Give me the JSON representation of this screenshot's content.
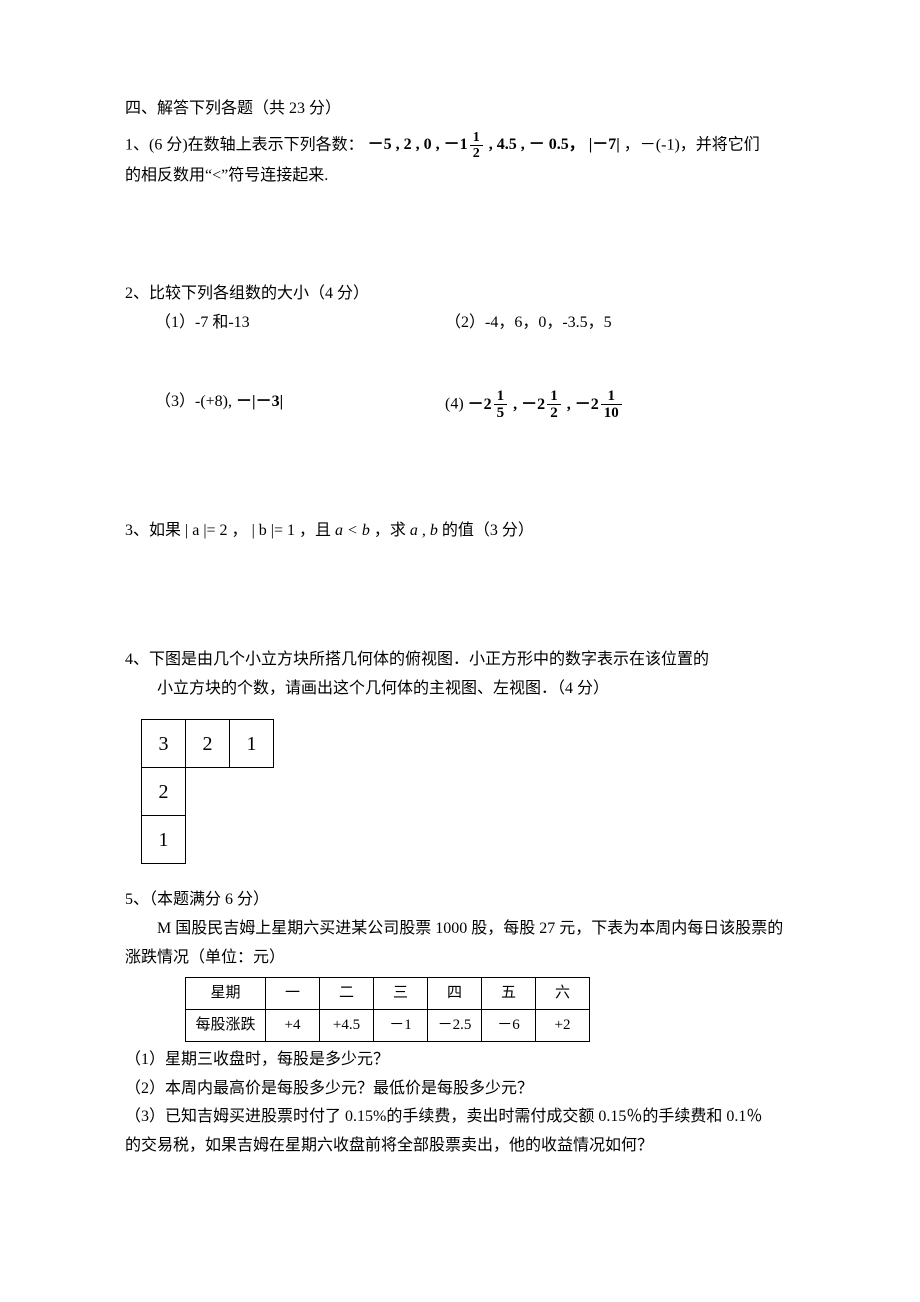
{
  "section": {
    "title": "四、解答下列各题（共 23 分）"
  },
  "q1": {
    "prefix": " 1、(6 分)在数轴上表示下列各数：",
    "nums_lead": "－5 , 2 , 0 , －1",
    "nums_mid": " , 4.5 , － 0.5，",
    "abs": "－7",
    "tail": "，－(-1)，并将它们",
    "line2": "的相反数用“<”符号连接起来."
  },
  "q2": {
    "title": "2、比较下列各组数的大小（4 分）",
    "s1": "（1）-7 和-13",
    "s2": "（2）-4，6，0，-3.5，5",
    "s3_lead": "（3）-(+8), ",
    "s3_neg": "－",
    "s3_abs": "－3",
    "s4_lead": "(4)  ",
    "s4_a": "－2",
    "s4_b": " , －2",
    "s4_c": " , －2"
  },
  "q3": {
    "lead": "3、如果",
    "abs_a": "| a |= 2",
    "mid1": "，",
    "abs_b": "| b |= 1",
    "mid2": "，且",
    "cond": "a < b",
    "mid3": "，求",
    "vars": "a , b",
    "tail": " 的值（3 分）"
  },
  "q4": {
    "l1": "4、下图是由几个小立方块所搭几何体的俯视图．小正方形中的数字表示在该位置的",
    "l2": "小立方块的个数，请画出这个几何体的主视图、左视图．（4 分）",
    "grid": [
      [
        "3",
        "2",
        "1"
      ],
      [
        "2",
        "",
        ""
      ],
      [
        "1",
        "",
        ""
      ]
    ]
  },
  "q5": {
    "title": "5、（本题满分 6 分）",
    "intro1": "M 国股民吉姆上星期六买进某公司股票 1000 股，每股 27 元，下表为本周内每日该股票的",
    "intro2": "涨跌情况（单位：元）",
    "headers": [
      "星期",
      "一",
      "二",
      "三",
      "四",
      "五",
      "六"
    ],
    "row_label": "每股涨跌",
    "values": [
      "+4",
      "+4.5",
      "－1",
      "－2.5",
      "－6",
      "+2"
    ],
    "p1": "（1）星期三收盘时，每股是多少元？",
    "p2": "（2）本周内最高价是每股多少元？最低价是每股多少元？",
    "p3a": "（3）已知吉姆买进股票时付了 0.15%的手续费，卖出时需付成交额 0.15％的手续费和 0.1％",
    "p3b": "的交易税，如果吉姆在星期六收盘前将全部股票卖出，他的收益情况如何？"
  },
  "chart_data": {
    "type": "table",
    "title": "每日股票涨跌",
    "categories": [
      "一",
      "二",
      "三",
      "四",
      "五",
      "六"
    ],
    "values": [
      4,
      4.5,
      -1,
      -2.5,
      -6,
      2
    ],
    "ylabel": "每股涨跌（元）"
  }
}
